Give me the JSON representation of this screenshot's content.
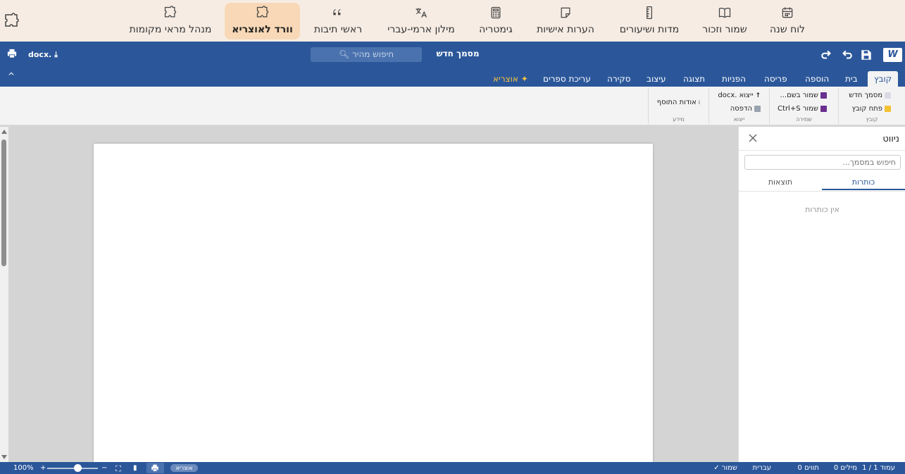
{
  "appbar": {
    "items": [
      {
        "label": "לוח שנה",
        "icon": "calendar-icon"
      },
      {
        "label": "שמור וזכור",
        "icon": "book-icon"
      },
      {
        "label": "מדות ושיעורים",
        "icon": "ruler-icon"
      },
      {
        "label": "הערות אישיות",
        "icon": "note-icon"
      },
      {
        "label": "גימטריה",
        "icon": "calculator-icon"
      },
      {
        "label": "מילון ארמי-עברי",
        "icon": "translate-icon"
      },
      {
        "label": "ראשי תיבות",
        "icon": "quote-icon"
      },
      {
        "label": "וורד לאוצריא",
        "icon": "puzzle-icon",
        "active": true
      },
      {
        "label": "מנהל מראי מקומות",
        "icon": "puzzle-icon"
      }
    ]
  },
  "header": {
    "logo": "W",
    "doc_title": "מסמך חדש",
    "quick_search": "חיפוש מהיר",
    "docx_label": "docx."
  },
  "tabs": [
    {
      "label": "קובץ",
      "active": true
    },
    {
      "label": "בית"
    },
    {
      "label": "הוספה"
    },
    {
      "label": "פריסה"
    },
    {
      "label": "הפניות"
    },
    {
      "label": "תצוגה"
    },
    {
      "label": "עיצוב"
    },
    {
      "label": "סקירה"
    },
    {
      "label": "עריכת ספרים"
    },
    {
      "label": "אוצריא ✦",
      "special": true
    }
  ],
  "ribbon": {
    "file_group": {
      "new": "מסמך חדש",
      "open": "פתח קובץ",
      "name": "קובץ"
    },
    "save_group": {
      "save_as": "...שמור בשם",
      "save": "Ctrl+S שמור",
      "name": "שמירה"
    },
    "export_group": {
      "export_docx": "docx. ייצוא",
      "print": "הדפסה",
      "name": "ייצוא"
    },
    "info_group": {
      "about": "אודות התוסף",
      "name": "מידע"
    }
  },
  "navpane": {
    "title": "ניווט",
    "search_placeholder": "חיפוש במסמך...",
    "tab_headings": "כותרות",
    "tab_results": "תוצאות",
    "empty_text": "אין כותרות"
  },
  "status": {
    "page": "עמוד 1 / 1",
    "words": "0 מילים",
    "chars": "0 תווים",
    "language": "עברית",
    "saved": "✓ שמור",
    "zoom": "100%",
    "zoom_fraction": 0.6,
    "badge": "אוצריא",
    "plus": "+",
    "minus": "−"
  },
  "colors": {
    "word_blue": "#2b579a",
    "appbar_bg": "#f6ece4",
    "active_app": "#f8d8b6"
  }
}
